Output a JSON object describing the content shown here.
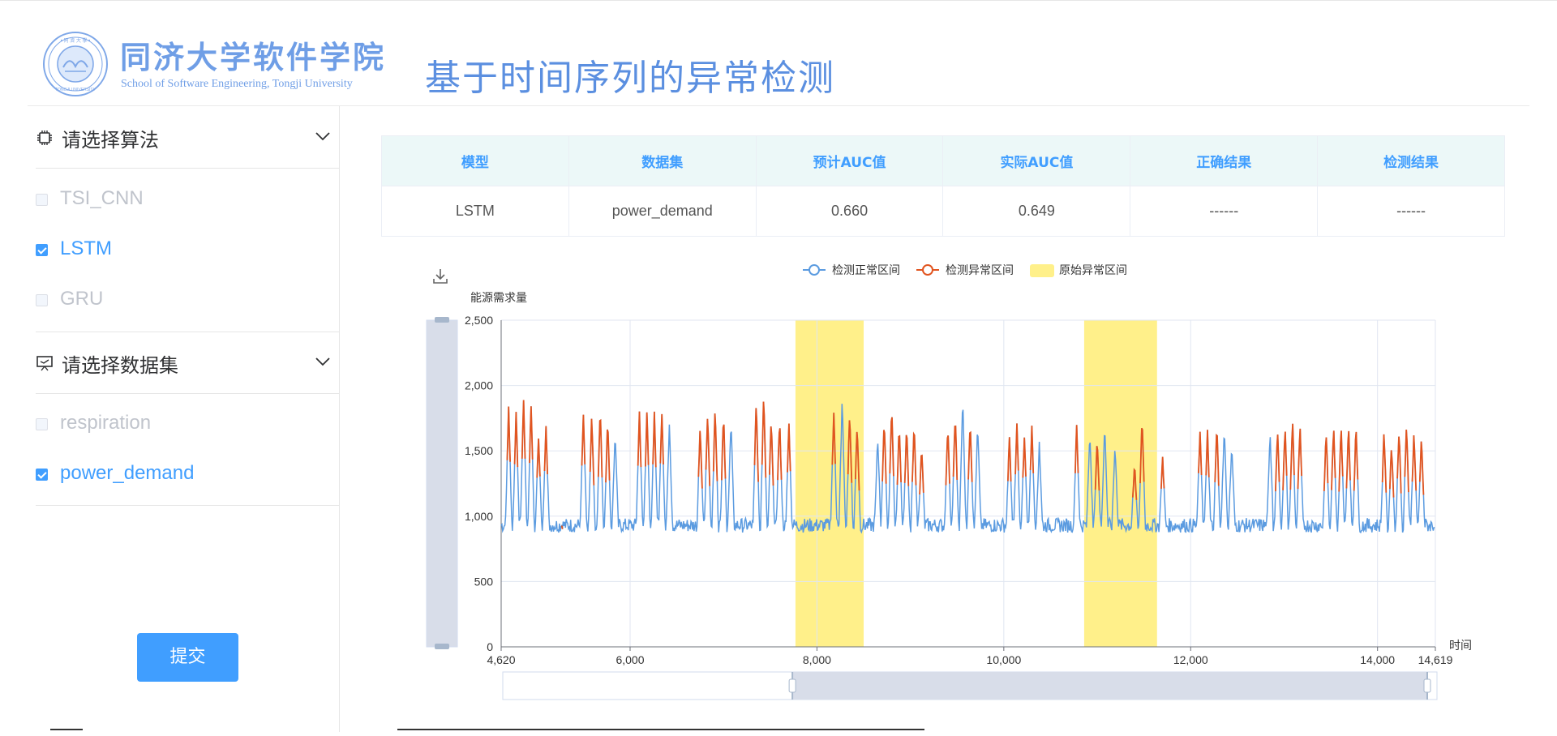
{
  "header": {
    "logo_cn": "同济大学软件学院",
    "logo_en": "School of Software Engineering, Tongji University",
    "title": "基于时间序列的异常检测"
  },
  "sidebar": {
    "algorithm_section": {
      "label": "请选择算法",
      "icon": "chip-icon"
    },
    "algorithms": [
      {
        "label": "TSI_CNN",
        "checked": false
      },
      {
        "label": "LSTM",
        "checked": true
      },
      {
        "label": "GRU",
        "checked": false
      }
    ],
    "dataset_section": {
      "label": "请选择数据集",
      "icon": "presentation-icon"
    },
    "datasets": [
      {
        "label": "respiration",
        "checked": false
      },
      {
        "label": "power_demand",
        "checked": true
      }
    ],
    "submit_label": "提交"
  },
  "table": {
    "headers": [
      "模型",
      "数据集",
      "预计AUC值",
      "实际AUC值",
      "正确结果",
      "检测结果"
    ],
    "row": [
      "LSTM",
      "power_demand",
      "0.660",
      "0.649",
      "------",
      "------"
    ]
  },
  "colors": {
    "accent": "#409eff",
    "normal_series": "#5b9be0",
    "anomaly_series": "#e1541f",
    "original_anomaly": "#fff08a"
  },
  "chart_data": {
    "type": "line",
    "ylabel": "能源需求量",
    "xlabel": "时间",
    "x_range": [
      4620,
      14619
    ],
    "ylim": [
      0,
      2500
    ],
    "y_ticks": [
      "0",
      "500",
      "1,000",
      "1,500",
      "2,000",
      "2,500"
    ],
    "x_ticks": [
      {
        "value": 4620,
        "label": "4,620"
      },
      {
        "value": 6000,
        "label": "6,000"
      },
      {
        "value": 8000,
        "label": "8,000"
      },
      {
        "value": 10000,
        "label": "10,000"
      },
      {
        "value": 12000,
        "label": "12,000"
      },
      {
        "value": 14000,
        "label": "14,000"
      },
      {
        "value": 14619,
        "label": "14,619"
      }
    ],
    "grid": true,
    "legend_position": "top",
    "series": [
      {
        "name": "检测正常区间",
        "color": "#5b9be0"
      },
      {
        "name": "检测异常区间",
        "color": "#e1541f"
      },
      {
        "name": "原始异常区间",
        "color": "#fff08a"
      }
    ],
    "original_anomaly_ranges": [
      [
        7770,
        8500
      ],
      [
        10860,
        11640
      ]
    ],
    "peaks": [
      {
        "x": 4700,
        "y": 1850,
        "anomaly": true
      },
      {
        "x": 4780,
        "y": 1800,
        "anomaly": true
      },
      {
        "x": 4860,
        "y": 1900,
        "anomaly": true
      },
      {
        "x": 4940,
        "y": 1850,
        "anomaly": true
      },
      {
        "x": 5020,
        "y": 1600,
        "anomaly": true
      },
      {
        "x": 5100,
        "y": 1700,
        "anomaly": true
      },
      {
        "x": 5300,
        "y": 900,
        "anomaly": true
      },
      {
        "x": 5500,
        "y": 1780,
        "anomaly": true
      },
      {
        "x": 5590,
        "y": 1780,
        "anomaly": true
      },
      {
        "x": 5680,
        "y": 1830,
        "anomaly": true
      },
      {
        "x": 5760,
        "y": 1760,
        "anomaly": true
      },
      {
        "x": 5840,
        "y": 1650,
        "anomaly": false
      },
      {
        "x": 6100,
        "y": 1800,
        "anomaly": true
      },
      {
        "x": 6180,
        "y": 1800,
        "anomaly": true
      },
      {
        "x": 6260,
        "y": 1800,
        "anomaly": true
      },
      {
        "x": 6340,
        "y": 1800,
        "anomaly": true
      },
      {
        "x": 6420,
        "y": 1700,
        "anomaly": false
      },
      {
        "x": 6750,
        "y": 1700,
        "anomaly": true
      },
      {
        "x": 6830,
        "y": 1800,
        "anomaly": true
      },
      {
        "x": 6910,
        "y": 1850,
        "anomaly": true
      },
      {
        "x": 7000,
        "y": 1800,
        "anomaly": true
      },
      {
        "x": 7080,
        "y": 1750,
        "anomaly": false
      },
      {
        "x": 7350,
        "y": 1900,
        "anomaly": true
      },
      {
        "x": 7430,
        "y": 1950,
        "anomaly": true
      },
      {
        "x": 7510,
        "y": 1750,
        "anomaly": true
      },
      {
        "x": 7600,
        "y": 1750,
        "anomaly": true
      },
      {
        "x": 7700,
        "y": 1700,
        "anomaly": true
      },
      {
        "x": 8180,
        "y": 1800,
        "anomaly": true
      },
      {
        "x": 8270,
        "y": 1900,
        "anomaly": false
      },
      {
        "x": 8350,
        "y": 1800,
        "anomaly": true
      },
      {
        "x": 8430,
        "y": 1700,
        "anomaly": true
      },
      {
        "x": 8650,
        "y": 1600,
        "anomaly": false
      },
      {
        "x": 8720,
        "y": 1750,
        "anomaly": true
      },
      {
        "x": 8800,
        "y": 1850,
        "anomaly": true
      },
      {
        "x": 8880,
        "y": 1700,
        "anomaly": true
      },
      {
        "x": 8960,
        "y": 1700,
        "anomaly": true
      },
      {
        "x": 9040,
        "y": 1700,
        "anomaly": true
      },
      {
        "x": 9120,
        "y": 1550,
        "anomaly": true
      },
      {
        "x": 9400,
        "y": 1700,
        "anomaly": true
      },
      {
        "x": 9480,
        "y": 1800,
        "anomaly": true
      },
      {
        "x": 9560,
        "y": 1920,
        "anomaly": false
      },
      {
        "x": 9640,
        "y": 1750,
        "anomaly": true
      },
      {
        "x": 9720,
        "y": 1700,
        "anomaly": false
      },
      {
        "x": 10060,
        "y": 1600,
        "anomaly": true
      },
      {
        "x": 10140,
        "y": 1700,
        "anomaly": true
      },
      {
        "x": 10220,
        "y": 1600,
        "anomaly": true
      },
      {
        "x": 10300,
        "y": 1700,
        "anomaly": true
      },
      {
        "x": 10380,
        "y": 1550,
        "anomaly": false
      },
      {
        "x": 10780,
        "y": 1700,
        "anomaly": true
      },
      {
        "x": 10920,
        "y": 1650,
        "anomaly": false
      },
      {
        "x": 11000,
        "y": 1600,
        "anomaly": true
      },
      {
        "x": 11080,
        "y": 1700,
        "anomaly": false
      },
      {
        "x": 11190,
        "y": 1550,
        "anomaly": false
      },
      {
        "x": 11400,
        "y": 1400,
        "anomaly": true
      },
      {
        "x": 11480,
        "y": 1750,
        "anomaly": true
      },
      {
        "x": 11700,
        "y": 1450,
        "anomaly": true
      },
      {
        "x": 12100,
        "y": 1650,
        "anomaly": true
      },
      {
        "x": 12180,
        "y": 1650,
        "anomaly": true
      },
      {
        "x": 12280,
        "y": 1700,
        "anomaly": true
      },
      {
        "x": 12360,
        "y": 1700,
        "anomaly": false
      },
      {
        "x": 12440,
        "y": 1550,
        "anomaly": false
      },
      {
        "x": 12850,
        "y": 1650,
        "anomaly": false
      },
      {
        "x": 12930,
        "y": 1650,
        "anomaly": true
      },
      {
        "x": 13010,
        "y": 1700,
        "anomaly": true
      },
      {
        "x": 13090,
        "y": 1750,
        "anomaly": true
      },
      {
        "x": 13170,
        "y": 1700,
        "anomaly": true
      },
      {
        "x": 13450,
        "y": 1650,
        "anomaly": true
      },
      {
        "x": 13530,
        "y": 1700,
        "anomaly": true
      },
      {
        "x": 13610,
        "y": 1700,
        "anomaly": true
      },
      {
        "x": 13690,
        "y": 1700,
        "anomaly": true
      },
      {
        "x": 13770,
        "y": 1700,
        "anomaly": true
      },
      {
        "x": 14070,
        "y": 1650,
        "anomaly": true
      },
      {
        "x": 14150,
        "y": 1550,
        "anomaly": true
      },
      {
        "x": 14230,
        "y": 1650,
        "anomaly": true
      },
      {
        "x": 14310,
        "y": 1700,
        "anomaly": true
      },
      {
        "x": 14390,
        "y": 1650,
        "anomaly": true
      },
      {
        "x": 14470,
        "y": 1600,
        "anomaly": true
      }
    ],
    "baseline": 930,
    "zoom": {
      "x_start_fraction": 0.31,
      "x_end_fraction": 1.0
    }
  },
  "toolbox": {
    "download_icon": "download-icon"
  }
}
